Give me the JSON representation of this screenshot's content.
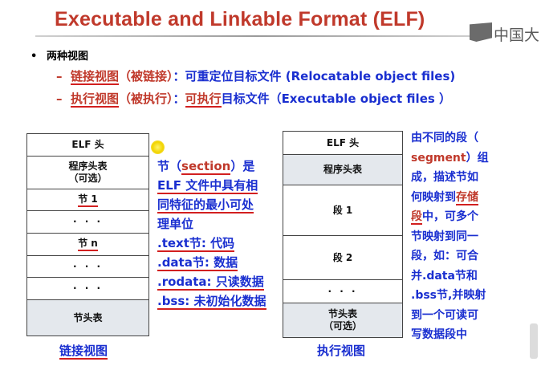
{
  "slide": {
    "title": "Executable and Linkable Format (ELF)",
    "watermark": "中国大",
    "bullet": "两种视图",
    "views": [
      {
        "dash": "–",
        "name": "链接视图",
        "paren": "（被链接）",
        "colon": "：",
        "desc": "可重定位目标文件 (Relocatable object files)"
      },
      {
        "dash": "–",
        "name": "执行视图",
        "paren": "（被执行）",
        "colon": "：",
        "desc_red": "可执行",
        "desc": "目标文件（Executable object files ）"
      }
    ]
  },
  "link_view": {
    "cells": [
      "ELF 头",
      "程序头表",
      "（可选）",
      "节 1",
      "· · ·",
      "节 n",
      "· · ·",
      "· · ·",
      "节头表"
    ],
    "caption": "链接视图"
  },
  "exec_view": {
    "cells": [
      "ELF 头",
      "程序头表",
      "段 1",
      "段 2",
      "· · ·",
      "节头表",
      "（可选）"
    ],
    "caption": "执行视图"
  },
  "section_note": {
    "line1_a": "节（",
    "line1_b": "section",
    "line1_c": "）是",
    "line2": "ELF 文件中具有相",
    "line3": "同特征的最小可处",
    "line4": "理单位",
    "line5": ".text节: 代码",
    "line6": ".data节: 数据",
    "line7": ".rodata: 只读数据",
    "line8": ".bss: 未初始化数据"
  },
  "segment_note": {
    "line1": "由不同的段（",
    "line2_red": "segment",
    "line2": "）组",
    "line3": "成，描述节如",
    "line4_a": "何映射到",
    "line4_red": "存储",
    "line5_red": "段",
    "line5": "中，可多个",
    "line6": "节映射到同一",
    "line7": "段，如：可合",
    "line8": "并.data节和",
    "line9": ".bss节,并映射",
    "line10": "到一个可读可",
    "line11": "写数据段中"
  },
  "colors": {
    "title_red": "#c0392b",
    "text_blue": "#1a2fd0",
    "shade": "#e4e8ed"
  }
}
